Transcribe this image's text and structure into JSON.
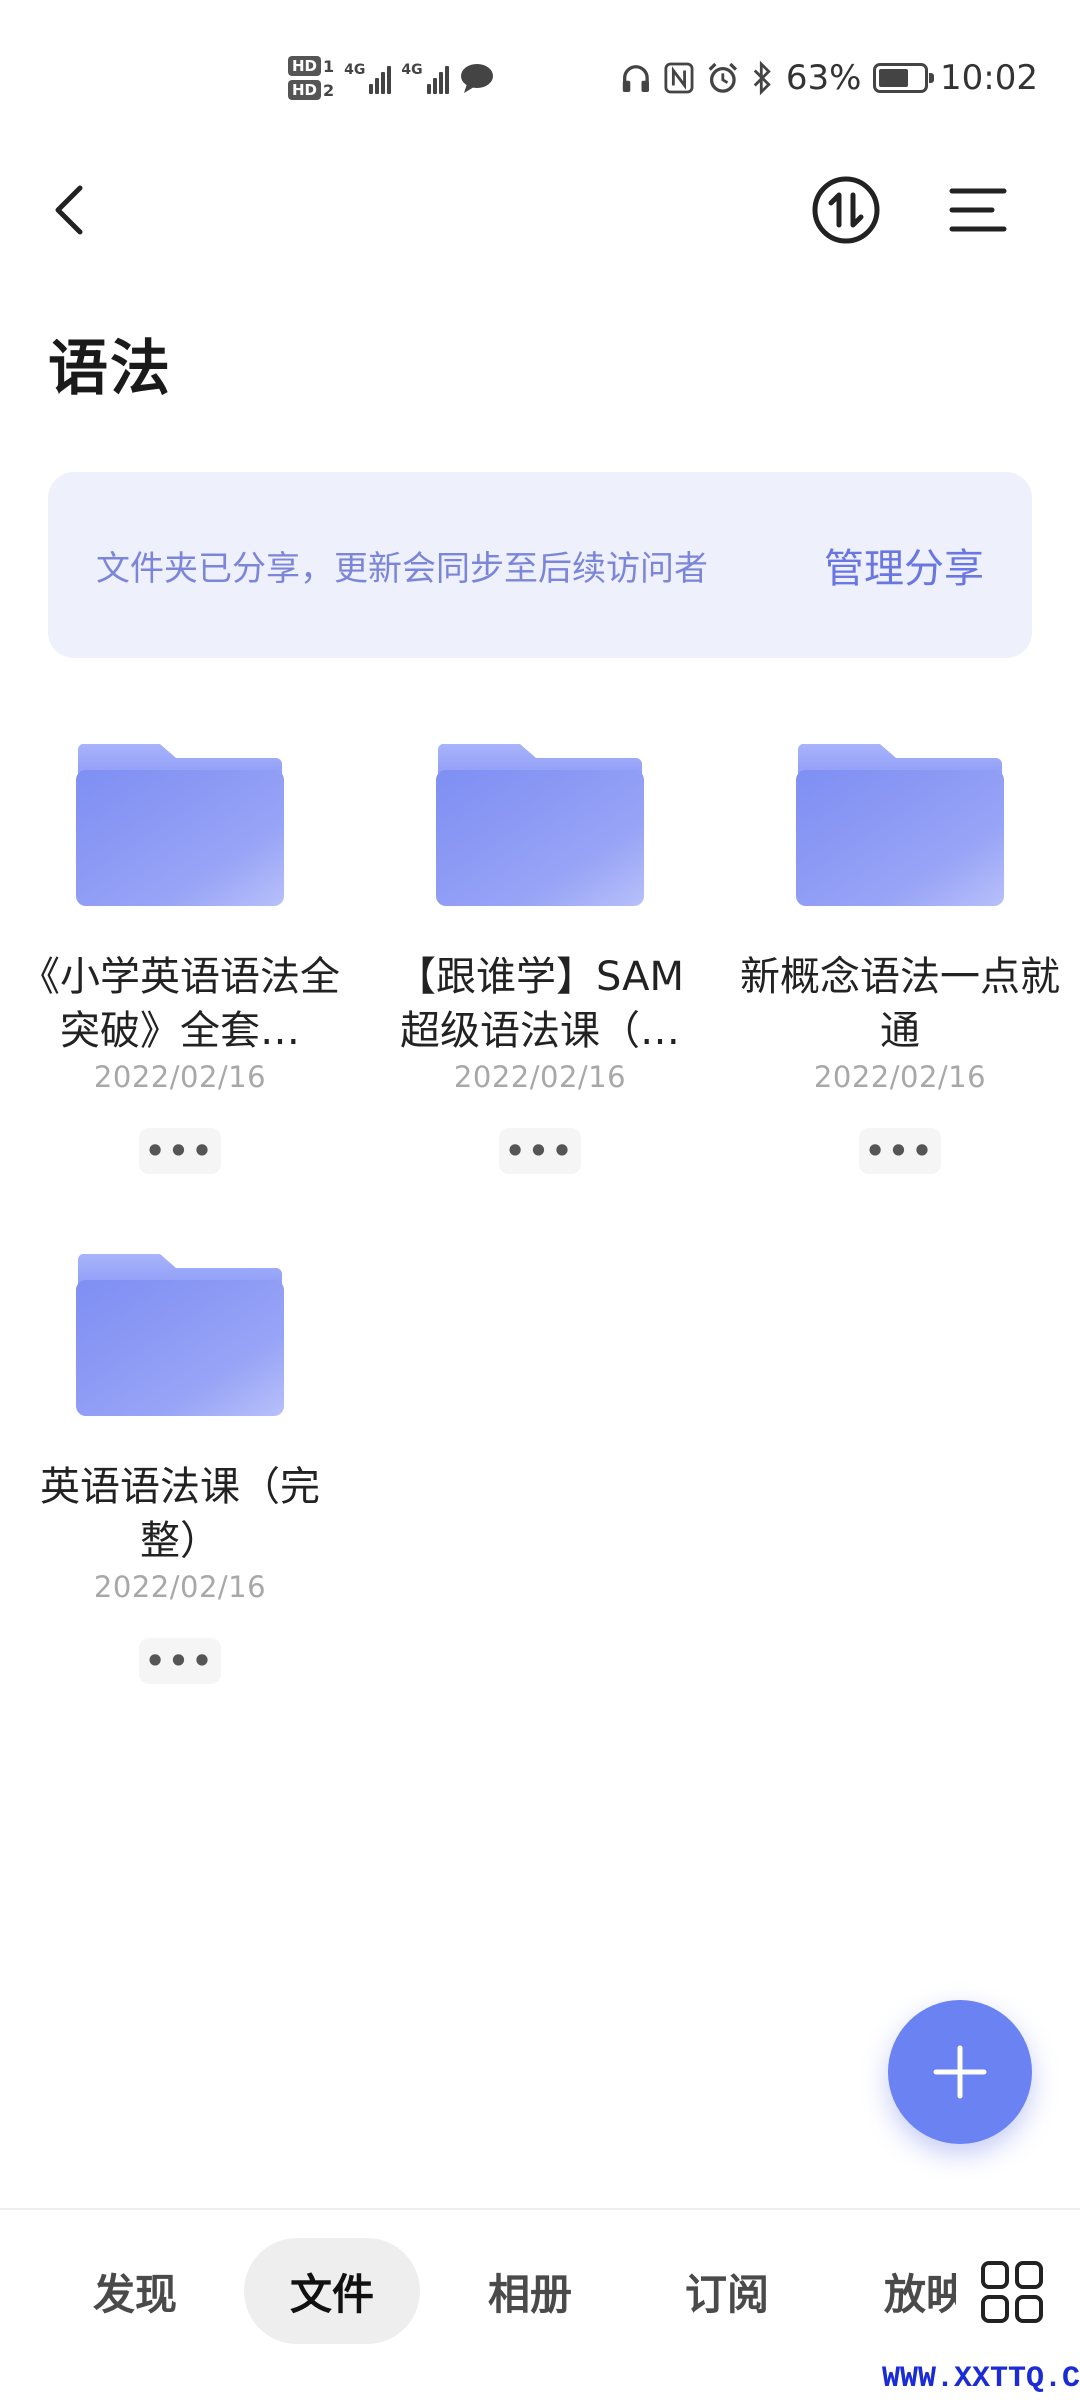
{
  "status_bar": {
    "hd1": "HD",
    "hd1_num": "1",
    "hd2": "HD",
    "hd2_num": "2",
    "net1": "4G",
    "net2": "4G",
    "battery_percent": "63%",
    "battery_level": 0.63,
    "time": "10:02",
    "icons": [
      "hd-sim-icon",
      "signal-icon",
      "message-icon",
      "headphones-icon",
      "nfc-icon",
      "alarm-icon",
      "bluetooth-icon",
      "battery-icon"
    ]
  },
  "header": {
    "back_icon": "chevron-left-icon",
    "sort_icon": "sort-arrows-icon",
    "menu_icon": "menu-icon"
  },
  "page": {
    "title": "语法"
  },
  "share_banner": {
    "text": "文件夹已分享，更新会同步至后续访问者",
    "action": "管理分享"
  },
  "folders": [
    {
      "name": "《小学英语语法全突破》全套…",
      "date": "2022/02/16",
      "more": "•••"
    },
    {
      "name": "【跟谁学】SAM超级语法课（…",
      "date": "2022/02/16",
      "more": "•••"
    },
    {
      "name": "新概念语法一点就通",
      "date": "2022/02/16",
      "more": "•••"
    },
    {
      "name": "英语语法课（完整）",
      "date": "2022/02/16",
      "more": "•••"
    }
  ],
  "fab": {
    "icon": "plus-icon"
  },
  "bottom_nav": {
    "tabs": [
      {
        "label": "发现",
        "active": false
      },
      {
        "label": "文件",
        "active": true
      },
      {
        "label": "相册",
        "active": false
      },
      {
        "label": "订阅",
        "active": false
      },
      {
        "label": "放映",
        "active": false
      }
    ],
    "grid_icon": "grid-icon"
  },
  "watermark": "WWW.XXTTQ.COM",
  "colors": {
    "accent": "#6a76e2",
    "banner_bg": "#eef0fc",
    "banner_text": "#7c86d8",
    "folder": "#7f8ff4",
    "fab": "#6a82f2",
    "watermark": "#1b2bd6"
  }
}
